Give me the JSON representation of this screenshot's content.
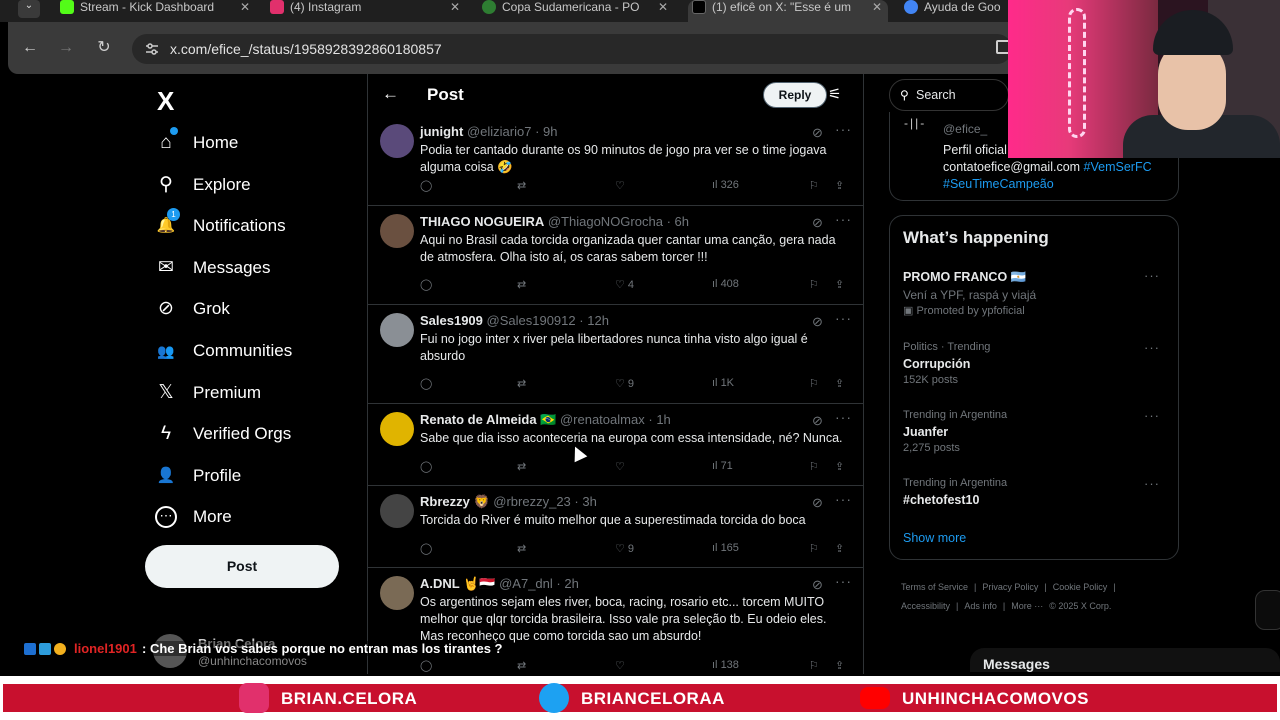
{
  "browser": {
    "tabs": [
      {
        "title": "Stream - Kick Dashboard",
        "favicon_color": "#53fc18"
      },
      {
        "title": "(4) Instagram",
        "favicon_color": "#e1306c"
      },
      {
        "title": "Copa Sudamericana - PO",
        "favicon_color": "#2e7d32"
      },
      {
        "title": "(1) eficê on X: \"Esse é um",
        "favicon_color": "#000000"
      },
      {
        "title": "Ayuda de Goo",
        "favicon_color": "#4285f4"
      }
    ],
    "close_glyph": "✕",
    "url": "x.com/efice_/status/1958928392860180857"
  },
  "nav": {
    "logo": "X",
    "items": [
      {
        "icon": "home-icon",
        "glyph": "⌂",
        "label": "Home"
      },
      {
        "icon": "search-icon",
        "glyph": "⚲",
        "label": "Explore"
      },
      {
        "icon": "bell-icon",
        "glyph": "🔔",
        "label": "Notifications",
        "badge": "1"
      },
      {
        "icon": "mail-icon",
        "glyph": "✉",
        "label": "Messages"
      },
      {
        "icon": "grok-icon",
        "glyph": "⊘",
        "label": "Grok"
      },
      {
        "icon": "communities-icon",
        "glyph": "👥",
        "label": "Communities"
      },
      {
        "icon": "x-premium-icon",
        "glyph": "𝕏",
        "label": "Premium"
      },
      {
        "icon": "lightning-icon",
        "glyph": "ϟ",
        "label": "Verified Orgs"
      },
      {
        "icon": "person-icon",
        "glyph": "👤",
        "label": "Profile"
      },
      {
        "icon": "more-circle-icon",
        "glyph": "⋯",
        "label": "More"
      }
    ],
    "post_label": "Post",
    "user": {
      "name": "Brian Celora",
      "handle": "@unhinchacomovos"
    }
  },
  "post_header": {
    "title": "Post",
    "reply_label": "Reply"
  },
  "replies": [
    {
      "name": "junight",
      "handle": "@eliziario7",
      "time": "9h",
      "text": "Podia ter cantado durante os 90 minutos de jogo pra ver se o time jogava alguma coisa 🤣",
      "likes": "",
      "views": "326",
      "avatar": "#5a4a7a"
    },
    {
      "name": "THIAGO NOGUEIRA",
      "handle": "@ThiagoNOGrocha",
      "time": "6h",
      "text": "Aqui no Brasil cada torcida organizada quer cantar uma canção, gera nada de atmosfera. Olha isto aí, os caras sabem torcer !!!",
      "likes": "4",
      "views": "408",
      "avatar": "#6a5040"
    },
    {
      "name": "Sales1909",
      "handle": "@Sales190912",
      "time": "12h",
      "text": "Fui no jogo inter x river pela libertadores nunca tinha visto algo igual é absurdo",
      "likes": "9",
      "views": "1K",
      "avatar": "#8a8f95"
    },
    {
      "name": "Renato de Almeida 🇧🇷",
      "handle": "@renatoalmax",
      "time": "1h",
      "text": "Sabe que dia isso aconteceria na europa com essa intensidade, né? Nunca.",
      "likes": "",
      "views": "71",
      "avatar": "#e0b400"
    },
    {
      "name": "Rbrezzy 🦁",
      "handle": "@rbrezzy_23",
      "time": "3h",
      "text": "Torcida do River é muito melhor que a superestimada torcida do boca",
      "likes": "9",
      "views": "165",
      "avatar": "#444444"
    },
    {
      "name": "A.DNL 🤘🇾🇪",
      "handle": "@A7_dnl",
      "time": "2h",
      "text": "Os argentinos sejam eles river, boca, racing, rosario etc... torcem MUITO melhor que qlqr torcida brasileira. Isso vale pra seleção tb. Eu odeio eles. Mas reconheço que como torcida sao um absurdo!",
      "likes": "",
      "views": "138",
      "avatar": "#7a6a55"
    }
  ],
  "right": {
    "search_placeholder": "Search",
    "profile_card": {
      "handle": "@efice_",
      "bio": "Perfil oficial",
      "email": "contatoefice@gmail.com",
      "tags": [
        "#VemSerFC",
        "#SeuTimeCampeão"
      ],
      "mark": "-||-"
    },
    "trends_title": "What’s happening",
    "trends": [
      {
        "context": "",
        "title": "PROMO FRANCO 🇦🇷",
        "sub": "Vení a YPF, raspá y viajá",
        "count": "Promoted by ypfoficial"
      },
      {
        "context": "Politics · Trending",
        "title": "Corrupción",
        "sub": "",
        "count": "152K posts"
      },
      {
        "context": "Trending in Argentina",
        "title": "Juanfer",
        "sub": "",
        "count": "2,275 posts"
      },
      {
        "context": "Trending in Argentina",
        "title": "#chetofest10",
        "sub": "",
        "count": ""
      }
    ],
    "show_more": "Show more",
    "footer": [
      "Terms of Service",
      "|",
      "Privacy Policy",
      "|",
      "Cookie Policy",
      "|",
      "Accessibility",
      "|",
      "Ads info",
      "|",
      "More ···",
      "© 2025 X Corp."
    ]
  },
  "stream": {
    "chat_user": "lionel1901",
    "chat_message": ": Che Brian vos sabes porque no entran mas los tirantes ?",
    "messages_label": "Messages",
    "socials": [
      {
        "icon": "instagram-icon",
        "handle": "BRIAN.CELORA",
        "color": "#e1306c"
      },
      {
        "icon": "twitter-icon",
        "handle": "BRIANCELORAA",
        "color": "#1da1f2"
      },
      {
        "icon": "youtube-icon",
        "handle": "UNHINCHACOMOVOS",
        "color": "#ff0000"
      }
    ]
  }
}
